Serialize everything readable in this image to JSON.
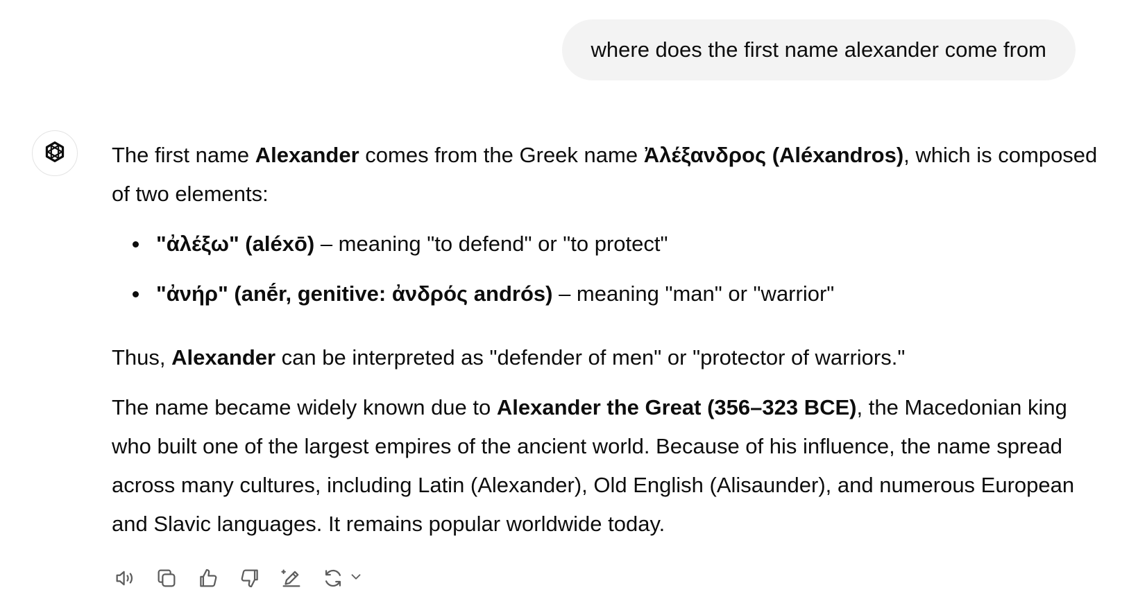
{
  "user_message": "where does the first name alexander come from",
  "assistant": {
    "intro": {
      "t1": "The first name ",
      "b1": "Alexander",
      "t2": " comes from the Greek name ",
      "b2": "Ἀλέξανδρος (Aléxandros)",
      "t3": ", which is composed of two elements:"
    },
    "elements": [
      {
        "term": "\"ἀλέξω\" (aléxō)",
        "meaning": " – meaning \"to defend\" or \"to protect\""
      },
      {
        "term": "\"ἀνήρ\" (anḗr, genitive: ἀνδρός andrós)",
        "meaning": " – meaning \"man\" or \"warrior\""
      }
    ],
    "thus": {
      "t1": "Thus, ",
      "b1": "Alexander",
      "t2": " can be interpreted as \"defender of men\" or \"protector of warriors.\""
    },
    "history": {
      "t1": "The name became widely known due to ",
      "b1": "Alexander the Great (356–323 BCE)",
      "t2": ", the Macedonian king who built one of the largest empires of the ancient world. Because of his influence, the name spread across many cultures, including Latin (Alexander), Old English (Alisaunder), and numerous European and Slavic languages. It remains popular worldwide today."
    }
  },
  "actions": {
    "icons": [
      "read-aloud-icon",
      "copy-icon",
      "thumbs-up-icon",
      "thumbs-down-icon",
      "edit-in-canvas-icon",
      "regenerate-icon",
      "chevron-down-icon"
    ]
  },
  "colors": {
    "text": "#0d0d0d",
    "bubble_bg": "#f3f3f3",
    "icon": "#5d5d5d"
  }
}
